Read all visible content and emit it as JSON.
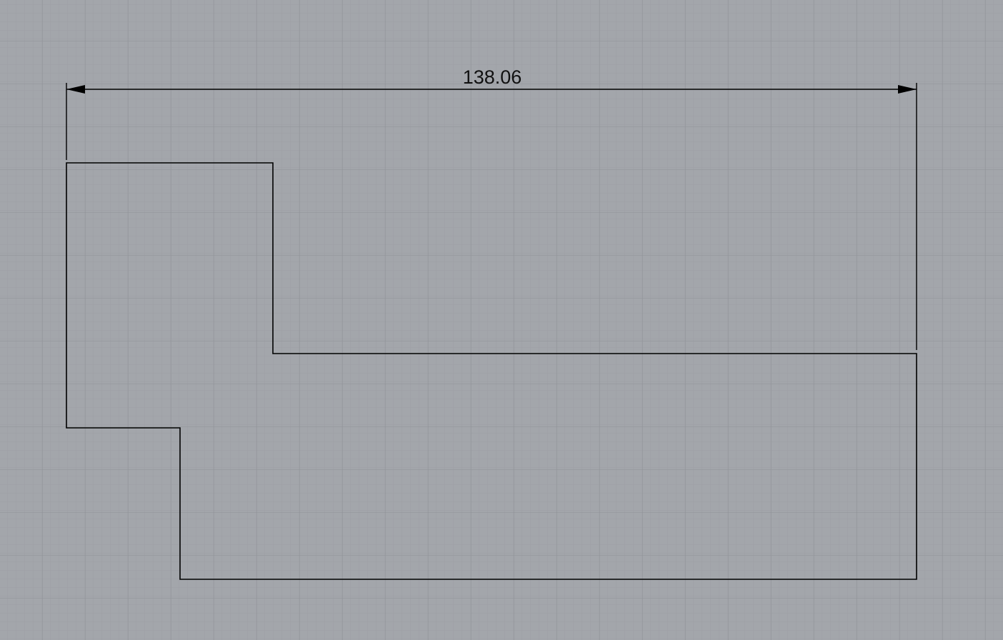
{
  "viewport": {
    "background_color": "#a3a6ab",
    "grid_minor_color": "#9a9da2",
    "grid_major_color": "#8f9297",
    "line_color": "#000000"
  },
  "dimension": {
    "value_label": "138.06"
  }
}
